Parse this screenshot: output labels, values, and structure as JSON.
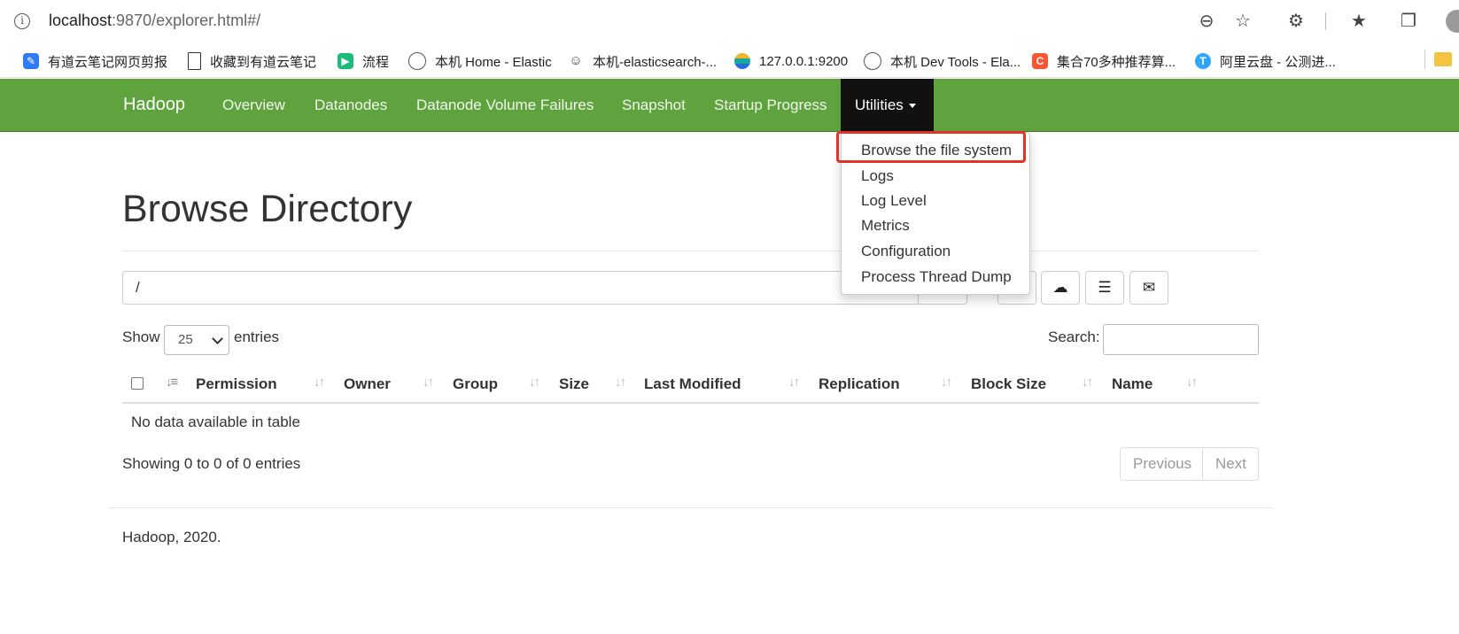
{
  "browser": {
    "url_host": "localhost",
    "url_path": ":9870/explorer.html#/",
    "bookmarks": [
      {
        "label": "有道云笔记网页剪报",
        "icon": "youdao-icon",
        "color": "#2f7bf6"
      },
      {
        "label": "收藏到有道云笔记",
        "icon": "page-icon",
        "color": "#ffffff"
      },
      {
        "label": "流程",
        "icon": "flow-icon",
        "color": "#1abc7a"
      },
      {
        "label": "本机 Home - Elastic",
        "icon": "elastic-icon",
        "color": "#ffffff"
      },
      {
        "label": "本机-elasticsearch-...",
        "icon": "elasticsearch-head-icon",
        "color": "#ffffff"
      },
      {
        "label": "127.0.0.1:9200",
        "icon": "elastic-logo-icon",
        "color": "#f0b429"
      },
      {
        "label": "本机 Dev Tools - Ela...",
        "icon": "elastic-icon",
        "color": "#ffffff"
      },
      {
        "label": "集合70多种推荐算...",
        "icon": "csdn-icon",
        "color": "#fc5531"
      },
      {
        "label": "阿里云盘 - 公测进...",
        "icon": "aliyun-drive-icon",
        "color": "#2ea6ff"
      }
    ]
  },
  "navbar": {
    "brand": "Hadoop",
    "items": [
      "Overview",
      "Datanodes",
      "Datanode Volume Failures",
      "Snapshot",
      "Startup Progress",
      "Utilities"
    ],
    "active": "Utilities",
    "bg_color": "#5fa33e"
  },
  "dropdown": {
    "items": [
      "Browse the file system",
      "Logs",
      "Log Level",
      "Metrics",
      "Configuration",
      "Process Thread Dump"
    ],
    "highlighted": "Browse the file system",
    "highlight_color": "#e53228"
  },
  "page": {
    "title": "Browse Directory",
    "path_value": "/",
    "show_label": "Show",
    "entries_label": "entries",
    "page_length": "25",
    "search_label": "Search:",
    "columns": [
      "Permission",
      "Owner",
      "Group",
      "Size",
      "Last Modified",
      "Replication",
      "Block Size",
      "Name"
    ],
    "empty_message": "No data available in table",
    "info": "Showing 0 to 0 of 0 entries",
    "prev_label": "Previous",
    "next_label": "Next",
    "footer": "Hadoop, 2020."
  }
}
